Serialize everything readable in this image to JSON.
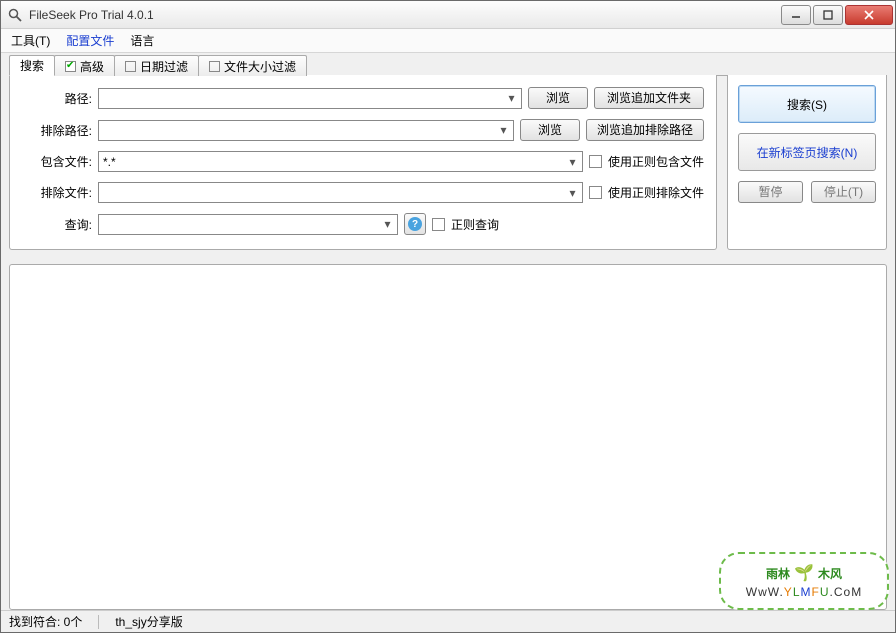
{
  "window": {
    "title": "FileSeek Pro Trial 4.0.1"
  },
  "menu": {
    "tools": "工具(T)",
    "config": "配置文件",
    "lang": "语言"
  },
  "tabs": {
    "search": "搜索",
    "advanced": "高级",
    "datefilter": "日期过滤",
    "sizefilter": "文件大小过滤"
  },
  "form": {
    "path_lbl": "路径:",
    "expath_lbl": "排除路径:",
    "inc_lbl": "包含文件:",
    "exc_lbl": "排除文件:",
    "query_lbl": "查询:",
    "include_val": "*.*",
    "browse": "浏览",
    "browse_add_folder": "浏览追加文件夹",
    "browse_add_expath": "浏览追加排除路径",
    "use_regex_inc": "使用正则包含文件",
    "use_regex_exc": "使用正则排除文件",
    "regex_query": "正则查询"
  },
  "side": {
    "search": "搜索(S)",
    "search_newtab": "在新标签页搜索(N)",
    "pause": "暂停",
    "stop": "停止(T)"
  },
  "status": {
    "found": "找到符合: 0个",
    "share": "th_sjy分享版"
  },
  "watermark": {
    "top": "雨林",
    "top2": "木风",
    "bottom_text": "WwW.YLMFU.CoM"
  }
}
